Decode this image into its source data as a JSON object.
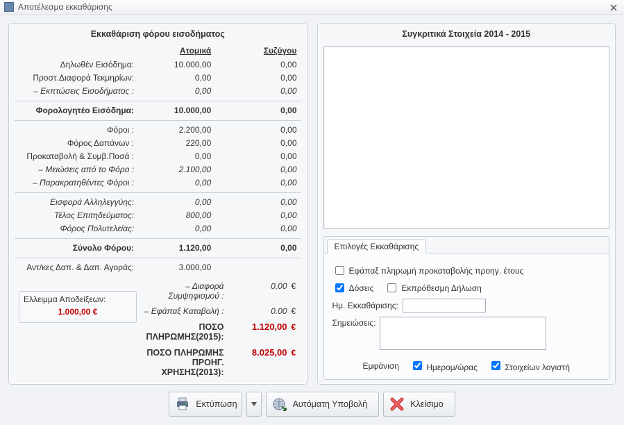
{
  "window": {
    "title": "Αποτέλεσμα εκκαθάρισης"
  },
  "left_panel": {
    "title": "Εκκαθάριση φόρου εισοδήματος",
    "headers": {
      "personal": "Ατομικά",
      "spouse": "Συζύγου"
    },
    "rows1": [
      {
        "label": "Δηλωθέν Εισόδημα:",
        "a": "10.000,00",
        "b": "0,00"
      },
      {
        "label": "Προστ.Διαφορά Τεκμηρίων:",
        "a": "0,00",
        "b": "0,00"
      },
      {
        "label": "– Εκπτώσεις Εισοδήματος :",
        "a": "0,00",
        "b": "0,00",
        "italic": true
      }
    ],
    "taxable": {
      "label": "Φορολογητέο Εισόδημα:",
      "a": "10.000,00",
      "b": "0,00"
    },
    "rows2": [
      {
        "label": "Φόροι :",
        "a": "2.200,00",
        "b": "0,00"
      },
      {
        "label": "Φόρος Δαπάνων :",
        "a": "220,00",
        "b": "0,00"
      },
      {
        "label": "Προκαταβολή & Συμβ.Ποσά :",
        "a": "0,00",
        "b": "0,00"
      },
      {
        "label": "– Μειώσεις από το Φόρο :",
        "a": "2.100,00",
        "b": "0,00",
        "italic": true
      },
      {
        "label": "– Παρακρατηθέντες Φόροι :",
        "a": "0,00",
        "b": "0,00",
        "italic": true
      }
    ],
    "rows3": [
      {
        "label": "Εισφορά Αλληλεγγύης:",
        "a": "0,00",
        "b": "0,00",
        "italic": true
      },
      {
        "label": "Τέλος Επιτηδεύματος:",
        "a": "800,00",
        "b": "0,00",
        "italic": true
      },
      {
        "label": "Φόρος Πολυτελείας:",
        "a": "0,00",
        "b": "0,00",
        "italic": true
      }
    ],
    "total": {
      "label": "Σύνολο Φόρου:",
      "a": "1.120,00",
      "b": "0,00"
    },
    "purchase": {
      "label": "Αντ/κες Δαπ. & Δαπ. Αγοράς:",
      "a": "3.000,00"
    },
    "deficit": {
      "label": "Ελλειμμα Αποδείξεων:",
      "value": "1.000,00  €"
    },
    "diff": {
      "label": "– Διαφορά Συμψηφισμού :",
      "value": "0,00",
      "eur": "€"
    },
    "lump": {
      "label": "– Εφάπαξ Καταβολή :",
      "value": "0.00",
      "eur": "€"
    },
    "pay_current": {
      "label": "ΠΟΣΟ ΠΛΗΡΩΜΗΣ(2015):",
      "value": "1.120,00",
      "eur": "€"
    },
    "pay_prev": {
      "label1": "ΠΟΣΟ ΠΛΗΡΩΜΗΣ ΠΡΟΗΓ.",
      "label2": "ΧΡΗΣΗΣ(2013):",
      "value": "8.025,00",
      "eur": "€"
    }
  },
  "right_panel": {
    "title": "Συγκριτικά Στοιχεία  2014 - 2015",
    "tab_label": "Επιλογές Εκκαθάρισης",
    "opt_lump": "Εφάπαξ πληρωμή προκαταβολής προηγ. έτους",
    "opt_installments": "Δόσεις",
    "opt_late": "Εκπρόθεσμη Δήλωση",
    "date_label": "Ημ. Εκκαθάρισης:",
    "notes_label": "Σημειώσεις:",
    "display_label": "Εμφάνιση",
    "opt_datetime": "Ημερομ/ώρας",
    "opt_accountant": "Στοιχείων λογιστή",
    "checked": {
      "installments": true,
      "late": false,
      "lump": false,
      "datetime": true,
      "accountant": true
    },
    "date_value": "",
    "notes_value": ""
  },
  "buttons": {
    "print": "Εκτύπωση",
    "auto_submit": "Αυτόματη Υποβολή",
    "close": "Κλείσιμο"
  }
}
